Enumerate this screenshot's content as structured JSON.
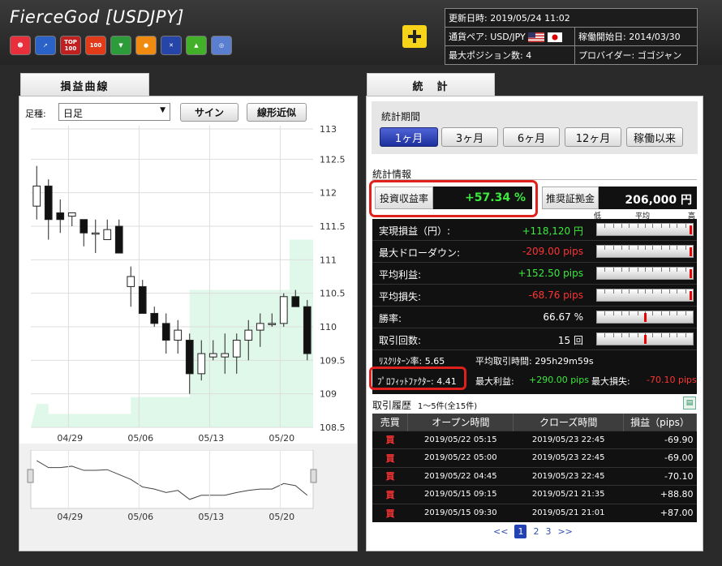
{
  "header": {
    "title": "FierceGod [USDJPY]",
    "updated": "更新日時: 2019/05/24 11:02",
    "pair_label": "通貨ペア: USD/JPY",
    "start_date": "稼働開始日: 2014/03/30",
    "max_positions": "最大ポジション数: 4",
    "provider": "プロバイダー: ゴゴジャン",
    "icons": [
      {
        "name": "smile-icon",
        "label": "☻",
        "color": "#e8303c"
      },
      {
        "name": "rocket-icon",
        "label": "➚",
        "color": "#2a62c8"
      },
      {
        "name": "top100-icon",
        "label": "TOP\n100",
        "color": "#c02020"
      },
      {
        "name": "flame100-icon",
        "label": "100",
        "color": "#e23b1a"
      },
      {
        "name": "beginner-icon",
        "label": "▼",
        "color": "#2c9c3a"
      },
      {
        "name": "orange-ball-icon",
        "label": "●",
        "color": "#f08a10"
      },
      {
        "name": "runner-icon",
        "label": "✕",
        "color": "#2546a8"
      },
      {
        "name": "tree-icon",
        "label": "▲",
        "color": "#43b02a"
      },
      {
        "name": "globe-icon",
        "label": "◎",
        "color": "#5b7fd0"
      }
    ]
  },
  "left": {
    "tab": "損益曲線",
    "frame_label": "足種:",
    "frame_value": "日足",
    "btn_sign": "サイン",
    "btn_linear": "線形近似",
    "y_ticks": [
      "113",
      "112.5",
      "112",
      "111.5",
      "111",
      "110.5",
      "110",
      "109.5",
      "109",
      "108.5"
    ],
    "x_ticks": [
      "04/29",
      "05/06",
      "05/13",
      "05/20"
    ],
    "nav_ticks": [
      "04/29",
      "05/06",
      "05/13",
      "05/20"
    ]
  },
  "chart_data": {
    "type": "candlestick",
    "ylim": [
      108.5,
      113
    ],
    "x_ticks": [
      "04/29",
      "05/06",
      "05/13",
      "05/20"
    ],
    "candles": [
      {
        "o": 111.8,
        "h": 112.4,
        "l": 111.6,
        "c": 112.1
      },
      {
        "o": 112.1,
        "h": 112.2,
        "l": 111.3,
        "c": 111.6
      },
      {
        "o": 111.7,
        "h": 111.9,
        "l": 111.4,
        "c": 111.6
      },
      {
        "o": 111.65,
        "h": 111.7,
        "l": 111.5,
        "c": 111.7
      },
      {
        "o": 111.6,
        "h": 111.6,
        "l": 111.2,
        "c": 111.4
      },
      {
        "o": 111.4,
        "h": 111.6,
        "l": 111.1,
        "c": 111.4
      },
      {
        "o": 111.3,
        "h": 111.6,
        "l": 111.3,
        "c": 111.45
      },
      {
        "o": 111.5,
        "h": 111.6,
        "l": 111.1,
        "c": 111.1
      },
      {
        "o": 110.6,
        "h": 110.9,
        "l": 110.3,
        "c": 110.75
      },
      {
        "o": 110.6,
        "h": 110.7,
        "l": 110.2,
        "c": 110.2
      },
      {
        "o": 110.2,
        "h": 110.3,
        "l": 110.0,
        "c": 110.05
      },
      {
        "o": 110.05,
        "h": 110.2,
        "l": 109.6,
        "c": 109.8
      },
      {
        "o": 109.8,
        "h": 110.1,
        "l": 109.6,
        "c": 109.95
      },
      {
        "o": 109.8,
        "h": 109.9,
        "l": 109.0,
        "c": 109.3
      },
      {
        "o": 109.3,
        "h": 109.8,
        "l": 109.2,
        "c": 109.6
      },
      {
        "o": 109.55,
        "h": 109.8,
        "l": 109.5,
        "c": 109.6
      },
      {
        "o": 109.55,
        "h": 109.9,
        "l": 109.3,
        "c": 109.6
      },
      {
        "o": 109.55,
        "h": 109.9,
        "l": 109.3,
        "c": 109.8
      },
      {
        "o": 109.8,
        "h": 110.1,
        "l": 109.5,
        "c": 109.95
      },
      {
        "o": 109.95,
        "h": 110.2,
        "l": 109.7,
        "c": 110.05
      },
      {
        "o": 110.05,
        "h": 110.2,
        "l": 110.0,
        "c": 110.05
      },
      {
        "o": 110.05,
        "h": 110.5,
        "l": 110.0,
        "c": 110.45
      },
      {
        "o": 110.45,
        "h": 110.55,
        "l": 110.3,
        "c": 110.3
      },
      {
        "o": 110.3,
        "h": 110.4,
        "l": 109.5,
        "c": 109.6
      }
    ],
    "area_steps": [
      {
        "from": 0,
        "to": 1,
        "y": 108.85
      },
      {
        "from": 1,
        "to": 8,
        "y": 108.7
      },
      {
        "from": 8,
        "to": 13,
        "y": 108.95
      },
      {
        "from": 13,
        "to": 21.5,
        "y": 110.55
      },
      {
        "from": 21.5,
        "to": 24,
        "y": 111.3
      }
    ]
  },
  "right": {
    "tab": "統　計",
    "period_title": "統計期間",
    "periods": [
      "1ヶ月",
      "3ヶ月",
      "6ヶ月",
      "12ヶ月",
      "稼働以来"
    ],
    "info_title": "統計情報",
    "roi_label": "投資収益率",
    "roi_value": "+57.34 %",
    "margin_label": "推奨証拠金",
    "margin_value": "206,000 円",
    "scale_low": "低",
    "scale_mid": "平均",
    "scale_high": "高",
    "stats": [
      {
        "label": "実現損益（円）:",
        "value": "+118,120 円",
        "color": "green",
        "mark": 0.98
      },
      {
        "label": "最大ドローダウン:",
        "value": "-209.00 pips",
        "color": "red",
        "mark": 0.98
      },
      {
        "label": "平均利益:",
        "value": "+152.50 pips",
        "color": "green",
        "mark": 0.98
      },
      {
        "label": "平均損失:",
        "value": "-68.76 pips",
        "color": "red",
        "mark": 0.98
      },
      {
        "label": "勝率:",
        "value": "66.67 %",
        "color": "white",
        "mark": 0.5
      },
      {
        "label": "取引回数:",
        "value": "15 回",
        "color": "white",
        "mark": 0.5
      }
    ],
    "risk_return": "ﾘｽｸﾘﾀｰﾝ率: 5.65",
    "avg_time": "平均取引時間: 295h29m59s",
    "pf": "ﾌﾟﾛﾌｨｯﾄﾌｧｸﾀｰ: 4.41",
    "max_profit_label": "最大利益:",
    "max_profit": "+290.00 pips",
    "max_loss_label": "最大損失:",
    "max_loss": "-70.10 pips",
    "history_title": "取引履歴",
    "history_range": "1～5件(全15件)",
    "history_headers": [
      "売買",
      "オープン時間",
      "クローズ時間",
      "損益（pips）"
    ],
    "history_rows": [
      {
        "side": "買",
        "open": "2019/05/22 05:15",
        "close": "2019/05/23 22:45",
        "pl": "-69.90",
        "color": "red"
      },
      {
        "side": "買",
        "open": "2019/05/22 05:00",
        "close": "2019/05/23 22:45",
        "pl": "-69.00",
        "color": "red"
      },
      {
        "side": "買",
        "open": "2019/05/22 04:45",
        "close": "2019/05/23 22:45",
        "pl": "-70.10",
        "color": "red"
      },
      {
        "side": "買",
        "open": "2019/05/15 09:15",
        "close": "2019/05/21 21:35",
        "pl": "+88.80",
        "color": "green"
      },
      {
        "side": "買",
        "open": "2019/05/15 09:30",
        "close": "2019/05/21 21:01",
        "pl": "+87.00",
        "color": "green"
      }
    ],
    "pager": {
      "prev": "<<",
      "pages": [
        "1",
        "2",
        "3"
      ],
      "next": ">>"
    }
  }
}
